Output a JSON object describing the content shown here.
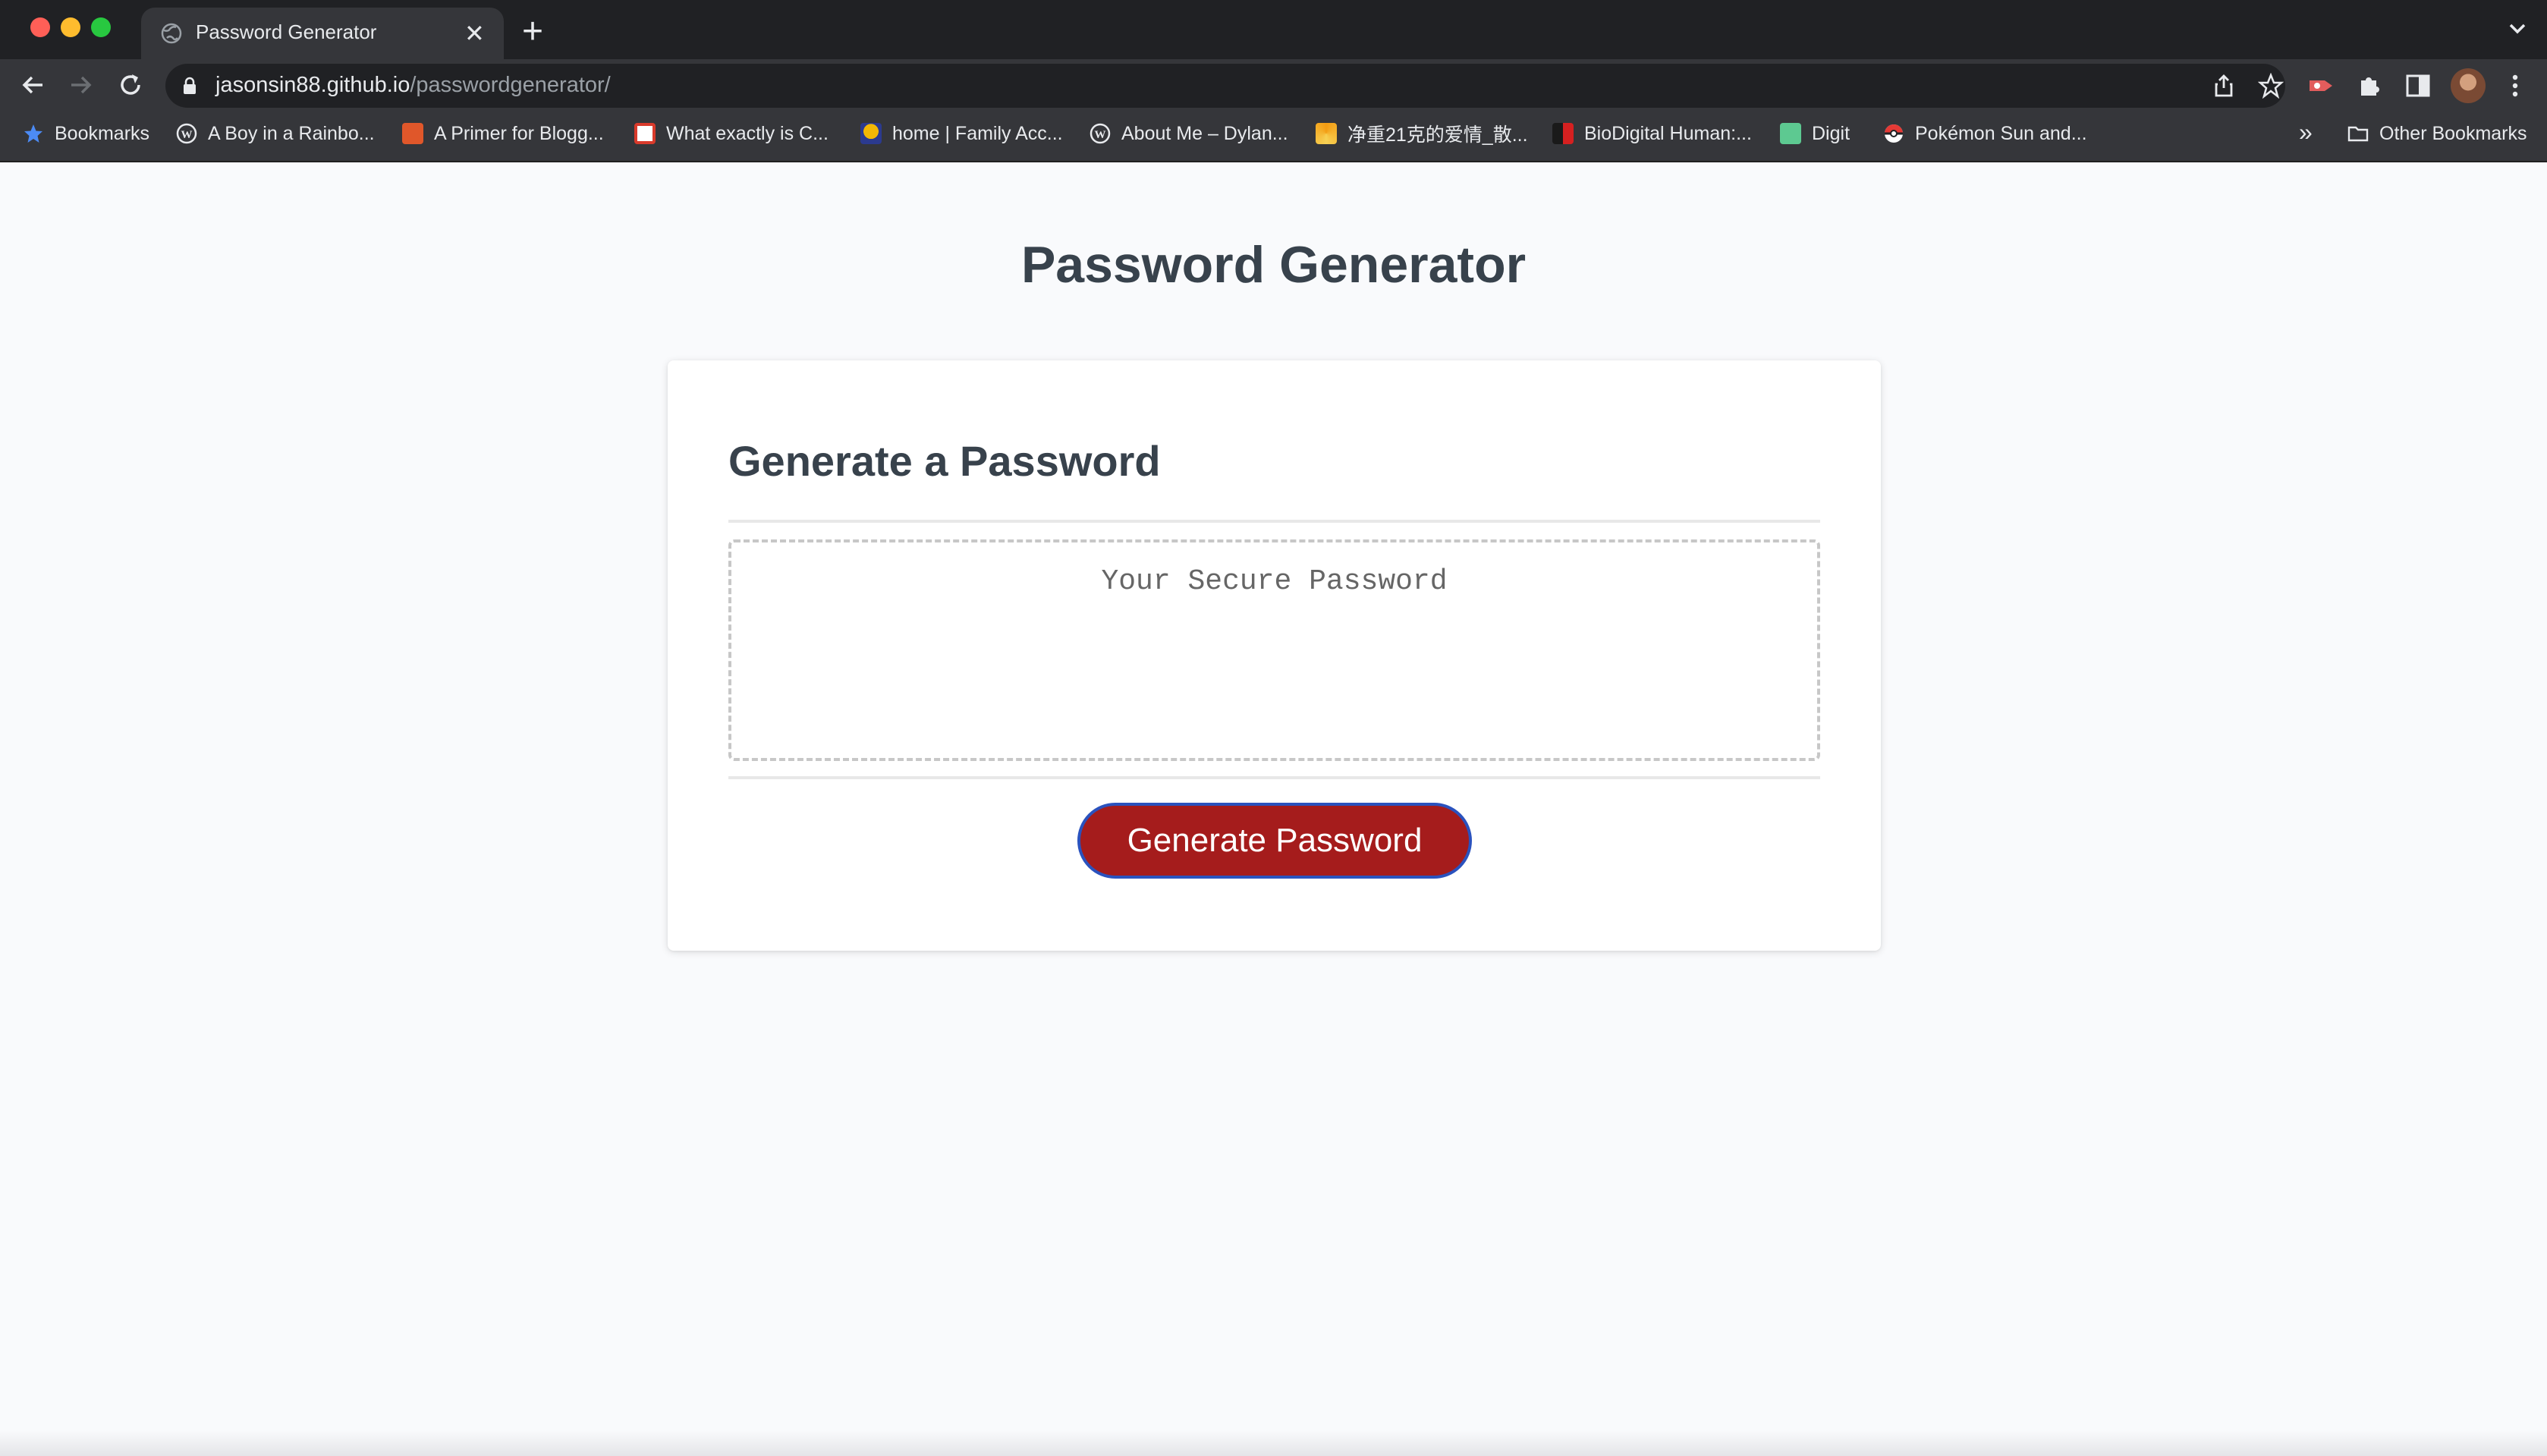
{
  "browser": {
    "tab": {
      "title": "Password Generator",
      "close": "✕"
    },
    "new_tab": "+",
    "address": {
      "host": "jasonsin88.github.io",
      "path": "/passwordgenerator/"
    },
    "bookmarks": [
      {
        "label": "Bookmarks",
        "icon": "star-icon",
        "color": "#4c8bf5"
      },
      {
        "label": "A Boy in a Rainbo...",
        "icon": "wordpress-icon",
        "color": "#e8eaed"
      },
      {
        "label": "A Primer for Blogg...",
        "icon": "cb-icon",
        "color": "#e0572a"
      },
      {
        "label": "What exactly is C...",
        "icon": "book-icon",
        "color": "#d93a2b"
      },
      {
        "label": "home | Family Acc...",
        "icon": "family-icon",
        "color": "#f2b705"
      },
      {
        "label": "About Me – Dylan...",
        "icon": "wordpress-icon",
        "color": "#e8eaed"
      },
      {
        "label": "净重21克的爱情_散...",
        "icon": "swirl-icon",
        "color": "#f39c12"
      },
      {
        "label": "BioDigital Human:...",
        "icon": "biodigital-icon",
        "color": "#d62020"
      },
      {
        "label": "Digit",
        "icon": "digit-icon",
        "color": "#5dc991"
      },
      {
        "label": "Pokémon Sun and...",
        "icon": "pokeball-icon",
        "color": "#e53935"
      }
    ],
    "bookmarks_overflow": "»",
    "other_bookmarks": "Other Bookmarks"
  },
  "page": {
    "title": "Password Generator",
    "card": {
      "header": "Generate a Password",
      "password_placeholder": "Your Secure Password",
      "button_label": "Generate Password"
    }
  },
  "colors": {
    "button_bg": "#a51c1c",
    "button_border": "#2a52be",
    "heading": "#38424c",
    "page_bg": "#f9fafc"
  }
}
